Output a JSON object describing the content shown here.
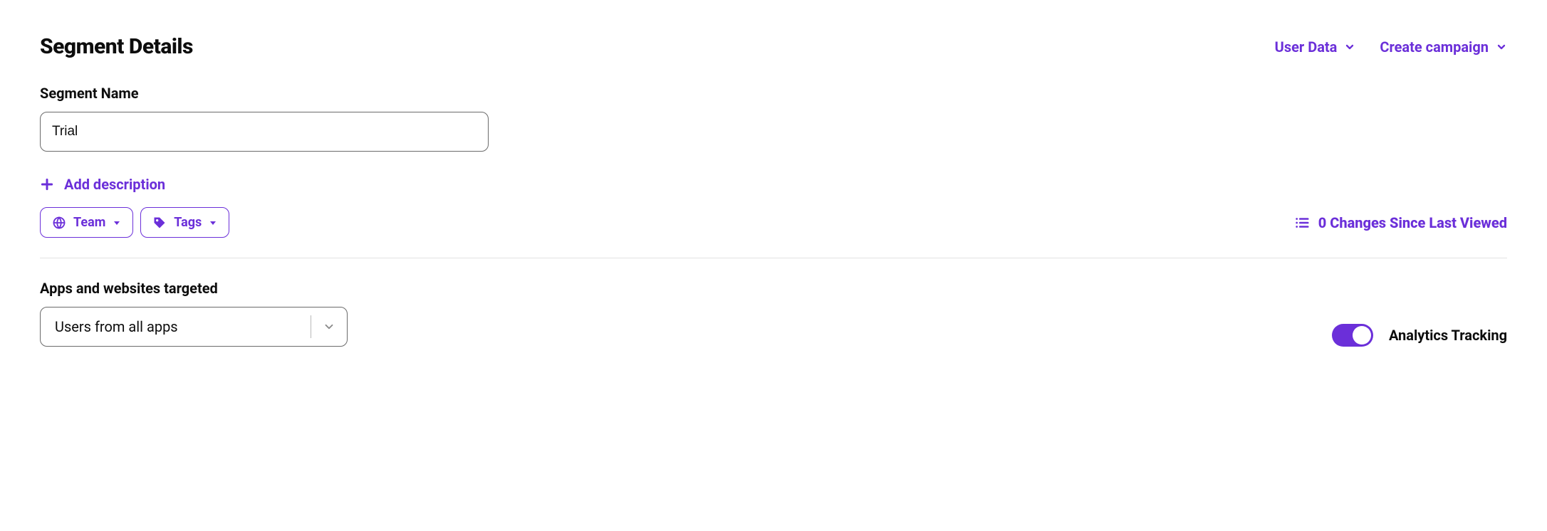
{
  "page": {
    "title": "Segment Details"
  },
  "header_actions": {
    "user_data": "User Data",
    "create_campaign": "Create campaign"
  },
  "segment_name": {
    "label": "Segment Name",
    "value": "Trial"
  },
  "add_description": {
    "label": "Add description"
  },
  "chips": {
    "team": "Team",
    "tags": "Tags"
  },
  "changes": {
    "text": "0 Changes Since Last Viewed"
  },
  "targeting": {
    "label": "Apps and websites targeted",
    "selected": "Users from all apps"
  },
  "analytics": {
    "label": "Analytics Tracking",
    "on": true
  },
  "colors": {
    "accent": "#6b2fd9"
  }
}
